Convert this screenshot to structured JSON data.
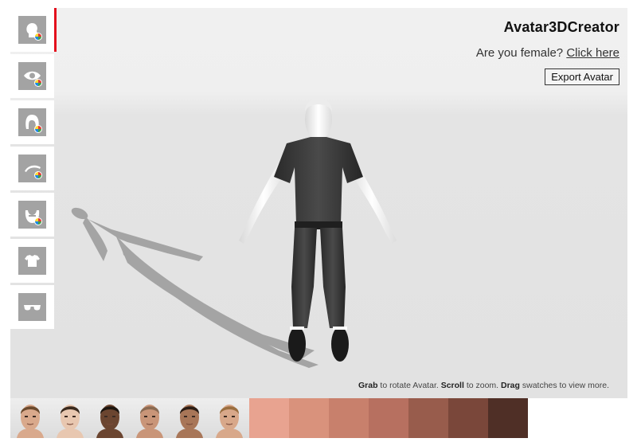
{
  "header": {
    "title": "Avatar3DCreator",
    "female_question": "Are you female?",
    "female_link": "Click here",
    "export_label": "Export Avatar"
  },
  "sidebar": {
    "items": [
      {
        "name": "skin",
        "icon": "head-color-icon",
        "active": true
      },
      {
        "name": "eyes",
        "icon": "eye-color-icon"
      },
      {
        "name": "hair",
        "icon": "hair-color-icon"
      },
      {
        "name": "eyebrows",
        "icon": "eyebrow-color-icon"
      },
      {
        "name": "beard",
        "icon": "beard-color-icon"
      },
      {
        "name": "shirt",
        "icon": "shirt-icon"
      },
      {
        "name": "glasses",
        "icon": "glasses-icon"
      }
    ]
  },
  "hint": {
    "grab": "Grab",
    "grab_text": "to rotate Avatar.",
    "scroll": "Scroll",
    "scroll_text": "to zoom.",
    "drag": "Drag",
    "drag_text": "swatches to view more."
  },
  "faces": [
    {
      "skin": "#d9a98c",
      "hair": "#6b4a2e"
    },
    {
      "skin": "#e8c7b0",
      "hair": "#3a2a1e"
    },
    {
      "skin": "#6b4530",
      "hair": "#1c140e"
    },
    {
      "skin": "#c99578",
      "hair": "#8a6a52"
    },
    {
      "skin": "#a87658",
      "hair": "#2a1c14"
    },
    {
      "skin": "#d8a88a",
      "hair": "#9a6e40"
    }
  ],
  "swatches": [
    "#e8a390",
    "#d9927c",
    "#c8806c",
    "#b77060",
    "#985c4c",
    "#7a473a",
    "#4f2f26"
  ]
}
